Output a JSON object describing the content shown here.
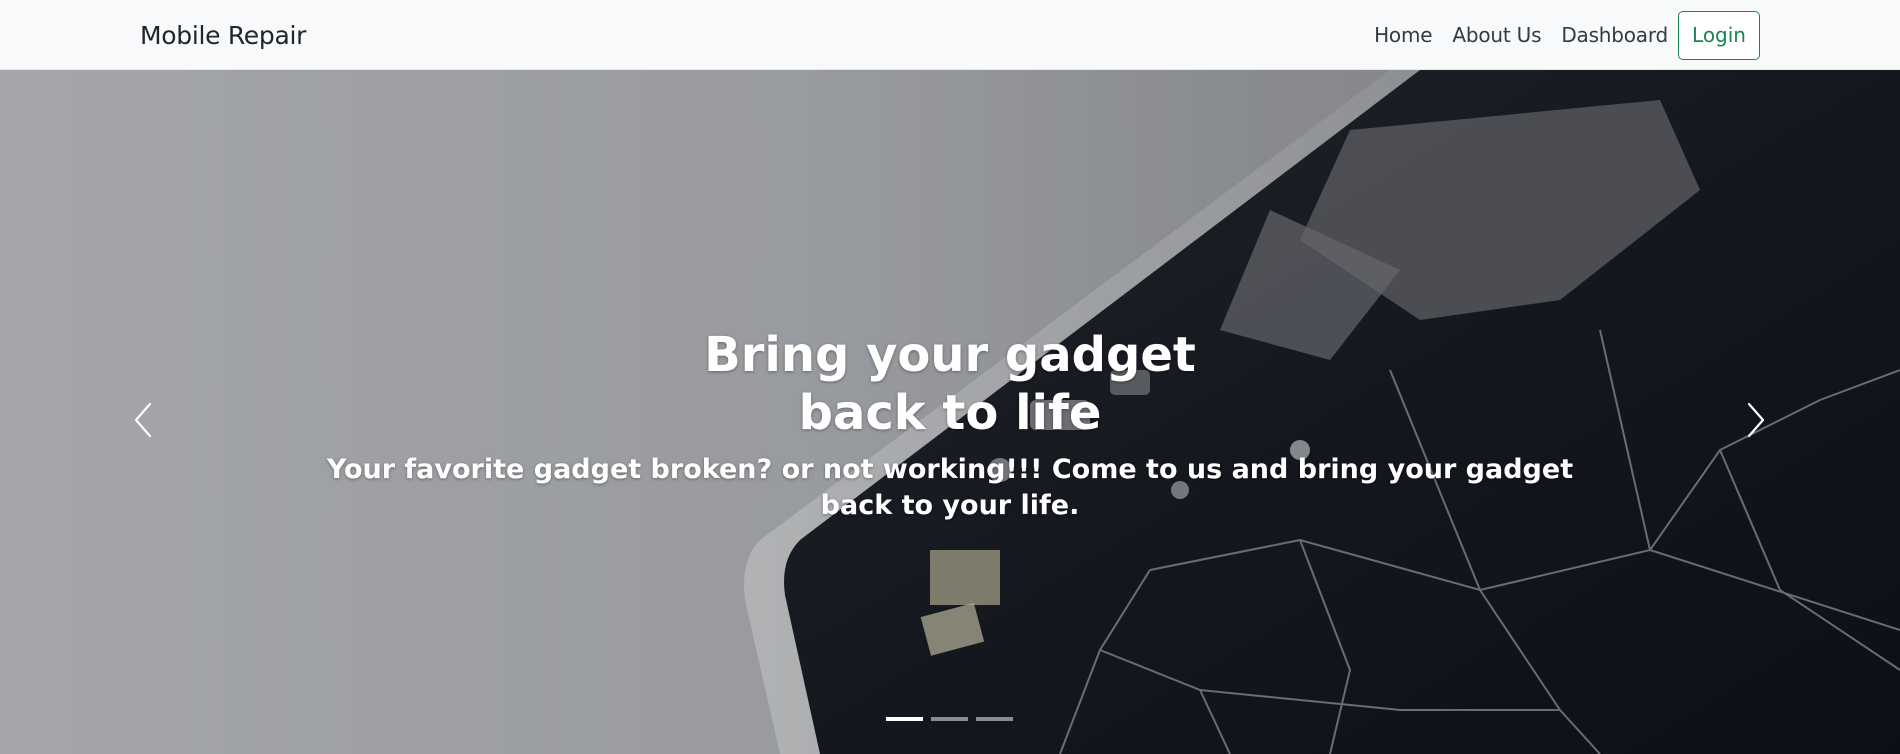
{
  "navbar": {
    "brand": "Mobile Repair",
    "links": [
      {
        "label": "Home"
      },
      {
        "label": "About Us"
      },
      {
        "label": "Dashboard"
      }
    ],
    "login_label": "Login",
    "login_color": "#198754"
  },
  "carousel": {
    "slide": {
      "title_line1": "Bring your gadget",
      "title_line2": "back to life",
      "text": "Your favorite gadget broken? or not working!!! Come to us and bring your gadget back to your life."
    },
    "prev_icon": "chevron-left-icon",
    "next_icon": "chevron-right-icon",
    "indicators": [
      {
        "active": true
      },
      {
        "active": false
      },
      {
        "active": false
      }
    ]
  }
}
